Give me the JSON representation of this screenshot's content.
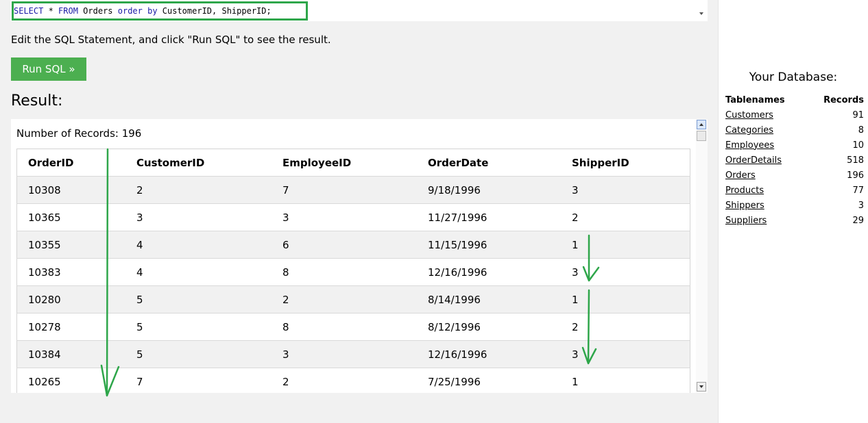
{
  "editor": {
    "sql_parts": [
      "SELECT",
      " * ",
      "FROM",
      " Orders ",
      "order by",
      " CustomerID, ShipperID;"
    ]
  },
  "instructions": "Edit the SQL Statement, and click \"Run SQL\" to see the result.",
  "run_button_label": "Run SQL »",
  "result": {
    "heading": "Result:",
    "record_count": "Number of Records: 196",
    "columns": [
      "OrderID",
      "CustomerID",
      "EmployeeID",
      "OrderDate",
      "ShipperID"
    ],
    "rows": [
      [
        "10308",
        "2",
        "7",
        "9/18/1996",
        "3"
      ],
      [
        "10365",
        "3",
        "3",
        "11/27/1996",
        "2"
      ],
      [
        "10355",
        "4",
        "6",
        "11/15/1996",
        "1"
      ],
      [
        "10383",
        "4",
        "8",
        "12/16/1996",
        "3"
      ],
      [
        "10280",
        "5",
        "2",
        "8/14/1996",
        "1"
      ],
      [
        "10278",
        "5",
        "8",
        "8/12/1996",
        "2"
      ],
      [
        "10384",
        "5",
        "3",
        "12/16/1996",
        "3"
      ],
      [
        "10265",
        "7",
        "2",
        "7/25/1996",
        "1"
      ]
    ]
  },
  "database": {
    "heading": "Your Database:",
    "columns": [
      "Tablenames",
      "Records"
    ],
    "tables": [
      [
        "Customers",
        "91"
      ],
      [
        "Categories",
        "8"
      ],
      [
        "Employees",
        "10"
      ],
      [
        "OrderDetails",
        "518"
      ],
      [
        "Orders",
        "196"
      ],
      [
        "Products",
        "77"
      ],
      [
        "Shippers",
        "3"
      ],
      [
        "Suppliers",
        "29"
      ]
    ]
  },
  "colors": {
    "accent_green": "#4caf50",
    "annotation_green": "#2ea64a",
    "sql_keyword": "#1a1aa6"
  }
}
